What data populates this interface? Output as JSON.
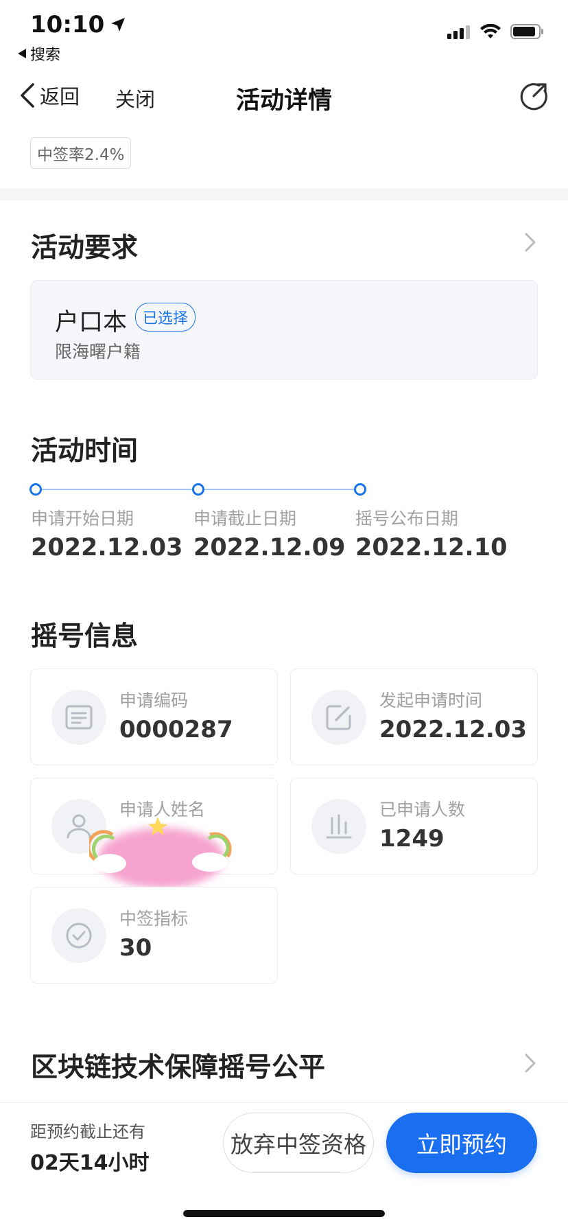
{
  "status_bar": {
    "time": "10:10",
    "back_app": "搜索"
  },
  "nav": {
    "back_label": "返回",
    "close_label": "关闭",
    "title": "活动详情"
  },
  "rate_badge": "中签率2.4%",
  "requirements": {
    "title": "活动要求",
    "item_name": "户口本",
    "item_tag": "已选择",
    "item_desc": "限海曙户籍"
  },
  "schedule": {
    "title": "活动时间",
    "steps": [
      {
        "label": "申请开始日期",
        "date": "2022.12.03"
      },
      {
        "label": "申请截止日期",
        "date": "2022.12.09"
      },
      {
        "label": "摇号公布日期",
        "date": "2022.12.10"
      }
    ]
  },
  "lottery_info": {
    "title": "摇号信息",
    "cards": [
      {
        "label": "申请编码",
        "value": "0000287",
        "icon": "document-icon"
      },
      {
        "label": "发起申请时间",
        "value": "2022.12.03",
        "icon": "edit-icon"
      },
      {
        "label": "申请人姓名",
        "value": "",
        "icon": "person-icon"
      },
      {
        "label": "已申请人数",
        "value": "1249",
        "icon": "bar-chart-icon"
      },
      {
        "label": "中签指标",
        "value": "30",
        "icon": "check-circle-icon"
      }
    ]
  },
  "blockchain": {
    "title": "区块链技术保障摇号公平"
  },
  "bottom_bar": {
    "countdown_label": "距预约截止还有",
    "countdown_value": "02天14小时",
    "giveup_label": "放弃中签资格",
    "book_label": "立即预约"
  },
  "colors": {
    "accent": "#1a6ff0",
    "timeline": "#1a73e8"
  }
}
